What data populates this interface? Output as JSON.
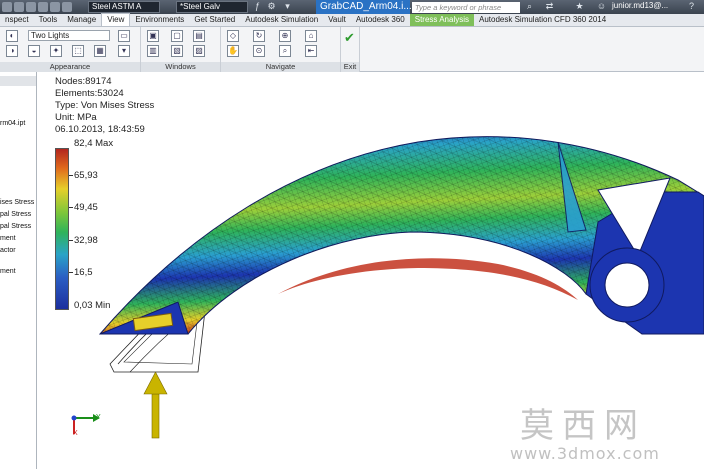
{
  "title_bar": {
    "material_combo": "Steel ASTM A",
    "appearance_combo": "*Steel Galv",
    "document_tab": "GrabCAD_Arm04.i...",
    "search_placeholder": "Type a keyword or phrase",
    "user": "junior.md13@...",
    "icons": [
      "new-icon",
      "open-icon",
      "save-icon",
      "undo-icon",
      "redo-icon",
      "binoculars-icon",
      "user-icon",
      "star-icon",
      "help-icon",
      "search-icon"
    ]
  },
  "ribbon_tabs": [
    {
      "label": "nspect"
    },
    {
      "label": "Tools"
    },
    {
      "label": "Manage"
    },
    {
      "label": "View",
      "active": true
    },
    {
      "label": "Environments"
    },
    {
      "label": "Get Started"
    },
    {
      "label": "Autodesk Simulation"
    },
    {
      "label": "Vault"
    },
    {
      "label": "Autodesk 360"
    },
    {
      "label": "Stress Analysis",
      "special": true
    },
    {
      "label": "Autodesk Simulation CFD 360 2014"
    }
  ],
  "ribbon": {
    "lighting_combo": "Two Lights",
    "panels": {
      "appearance": "Appearance",
      "windows": "Windows",
      "navigate": "Navigate",
      "exit": "Exit"
    }
  },
  "browser": {
    "items": [
      "rm04.ipt",
      "ises Stress",
      "pal Stress",
      "pal Stress",
      "ment",
      "actor",
      "ment"
    ]
  },
  "results": {
    "nodes": "Nodes:89174",
    "elements": "Elements:53024",
    "type": "Type: Von Mises Stress",
    "unit": "Unit: MPa",
    "timestamp": "06.10.2013, 18:43:59"
  },
  "legend": {
    "max_label": "82,4 Max",
    "min_label": "0,03 Min",
    "ticks": [
      "65,93",
      "49,45",
      "32,98",
      "16,5"
    ],
    "colors": [
      "#b3261e",
      "#e6cf2a",
      "#2fb35a",
      "#2aa3c7",
      "#1c2f9e"
    ]
  },
  "axis_triad": {
    "x_label": "Y",
    "z_label": "X"
  },
  "load_arrow_color": "#c9b400",
  "watermark": {
    "chinese": "莫西网",
    "url": "www.3dmox.com"
  }
}
